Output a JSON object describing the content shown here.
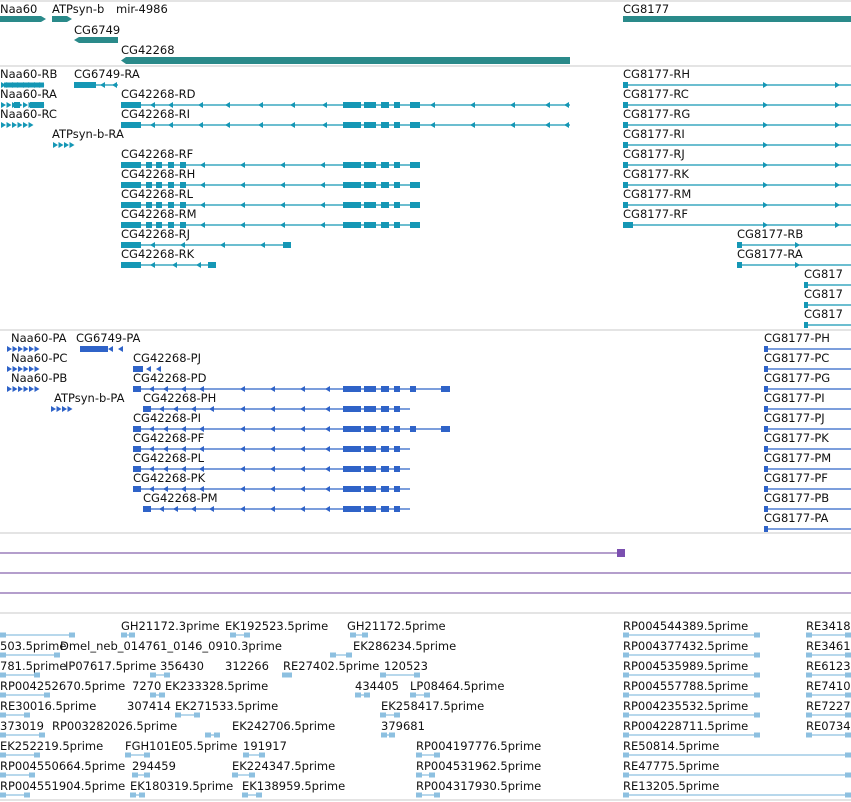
{
  "colors": {
    "gene": "#2a8a8a",
    "transcript": "#1597b5",
    "protein": "#2f63c8",
    "repeat": "#6a3d9a",
    "repeat_end": "#7b4fb0",
    "est": "#8dc0e0",
    "divider": "#c9c9c9"
  },
  "tracks": {
    "genes": {
      "labels": [
        "Naa60",
        "ATPsyn-b",
        "mir-4986",
        "CG6749",
        "CG42268",
        "CG8177"
      ]
    },
    "transcripts": {
      "left_labels": [
        "Naa60-RB",
        "CG6749-RA",
        "Naa60-RA",
        "Naa60-RC",
        "ATPsyn-b-RA",
        "CG42268-RD",
        "CG42268-RI",
        "CG42268-RF",
        "CG42268-RH",
        "CG42268-RL",
        "CG42268-RM",
        "CG42268-RJ",
        "CG42268-RK"
      ],
      "right_labels": [
        "CG8177-RH",
        "CG8177-RC",
        "CG8177-RG",
        "CG8177-RI",
        "CG8177-RJ",
        "CG8177-RK",
        "CG8177-RM",
        "CG8177-RF",
        "CG8177-RB",
        "CG8177-RA",
        "CG817",
        "CG817",
        "CG817"
      ]
    },
    "proteins": {
      "left_labels": [
        "Naa60-PA",
        "CG6749-PA",
        "Naa60-PC",
        "Naa60-PB",
        "ATPsyn-b-PA",
        "CG42268-PJ",
        "CG42268-PD",
        "CG42268-PH",
        "CG42268-PI",
        "CG42268-PF",
        "CG42268-PL",
        "CG42268-PK",
        "CG42268-PM"
      ],
      "right_labels": [
        "CG8177-PH",
        "CG8177-PC",
        "CG8177-PG",
        "CG8177-PI",
        "CG8177-PJ",
        "CG8177-PK",
        "CG8177-PM",
        "CG8177-PF",
        "CG8177-PB",
        "CG8177-PA"
      ]
    },
    "ests": {
      "labels": [
        "GH21172.3prime",
        "EK192523.5prime",
        "GH21172.5prime",
        "RP004544389.5prime",
        "RE3418",
        "503.5prime",
        "Dmel_neb_014761_0146_0910.3prime",
        "EK286234.5prime",
        "RP004377432.5prime",
        "RE3461",
        "781.5prime",
        "IP07617.5prime",
        "356430",
        "312266",
        "RE27402.5prime",
        "120523",
        "RP004535989.5prime",
        "RE6123",
        "RP004252670.5prime",
        "7270",
        "EK233328.5prime",
        "434405",
        "LP08464.5prime",
        "RP004557788.5prime",
        "RE7410",
        "RE30016.5prime",
        "307414",
        "EK271533.5prime",
        "EK258417.5prime",
        "RP004235532.5prime",
        "RE7227",
        "373019",
        "RP003282026.5prime",
        "EK242706.5prime",
        "379681",
        "RP004228711.5prime",
        "RE0734",
        "EK252219.5prime",
        "FGH101E05.5prime",
        "191917",
        "RP004197776.5prime",
        "RE50814.5prime",
        "RP004550664.5prime",
        "294459",
        "EK224347.5prime",
        "RP004531962.5prime",
        "RE47775.5prime",
        "RP004551904.5prime",
        "EK180319.5prime",
        "EK138959.5prime",
        "RP004317930.5prime",
        "RE13205.5prime"
      ]
    }
  }
}
